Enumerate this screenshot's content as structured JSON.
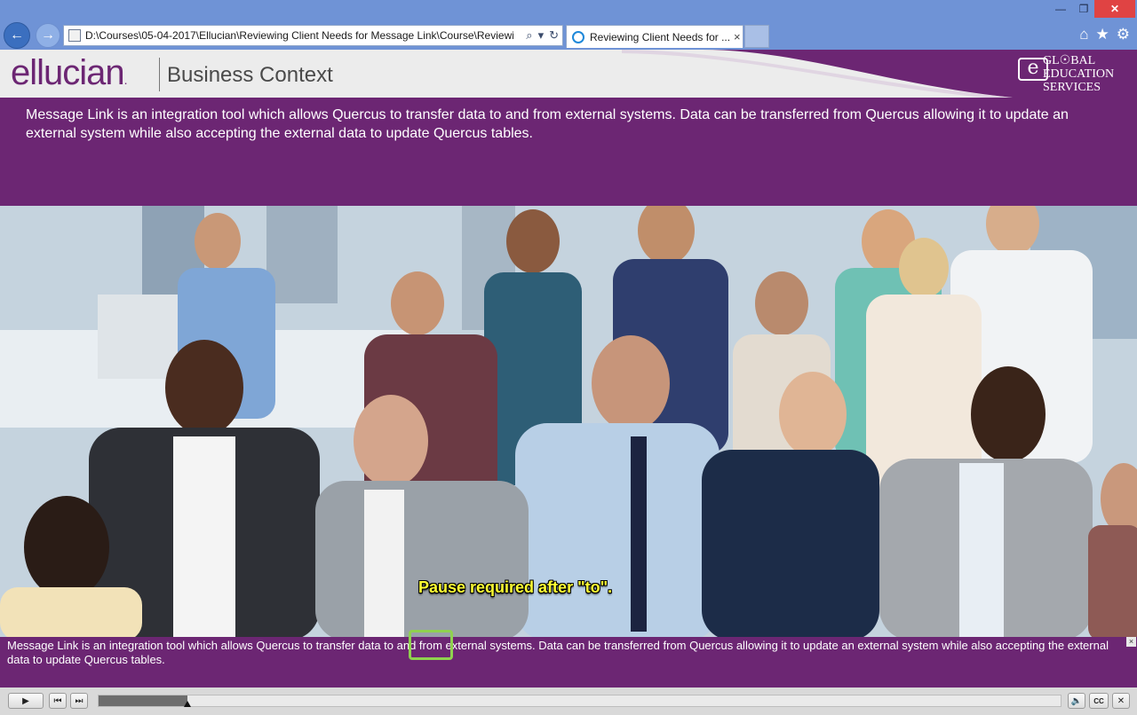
{
  "browser": {
    "address": "D:\\Courses\\05-04-2017\\Ellucian\\Reviewing Client Needs for Message Link\\Course\\Reviewin",
    "tab_title": "Reviewing Client Needs for ...",
    "tab_close": "×",
    "back_glyph": "←",
    "forward_glyph": "→",
    "search_glyph": "⌕",
    "dropdown_glyph": "▾",
    "refresh_glyph": "↻",
    "home_glyph": "⌂",
    "favorites_glyph": "★",
    "settings_glyph": "⚙",
    "minimize_glyph": "—",
    "restore_glyph": "❐",
    "close_glyph": "✕"
  },
  "header": {
    "logo": "ellucian",
    "logo_mark": ".",
    "title": "Business Context",
    "partner_logo": {
      "mark": "e",
      "lines": [
        "GL☉BAL",
        "EDUCATION",
        "SERVICES"
      ]
    }
  },
  "intro": {
    "text": "Message Link is an integration tool which allows Quercus to transfer data to and from external systems. Data can be transferred from Quercus allowing it to update an external system while also accepting the external data to update Quercus tables."
  },
  "callout": {
    "text": "Pause required after \"to\"."
  },
  "caption": {
    "text": "Message Link is an integration tool which allows Quercus to transfer data to and from external systems. Data can be transferred from Quercus allowing it to update an external system while also accepting the external data to update Quercus tables.",
    "close_glyph": "×"
  },
  "player": {
    "play_glyph": "▶",
    "rewind_glyph": "⏮",
    "forward_glyph": "⏭",
    "progress": 0.092,
    "volume_glyph": "🔈",
    "cc_label": "CC",
    "close_glyph": "✕"
  },
  "colors": {
    "brand_purple": "#6c2673",
    "chrome_blue": "#6f93d6",
    "callout_yellow": "#ffff33",
    "highlight_green": "#8fd14f"
  }
}
